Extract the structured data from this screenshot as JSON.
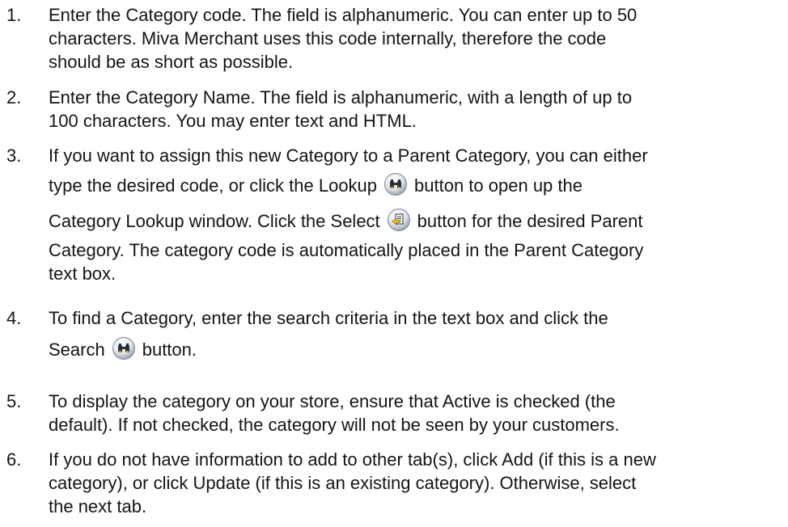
{
  "steps": [
    {
      "number": "1.",
      "lines": [
        "Enter the Category code. The field is alphanumeric. You can enter up to 50",
        "characters. Miva Merchant uses this code internally, therefore the code",
        "should be as short as possible."
      ]
    },
    {
      "number": "2.",
      "lines": [
        "Enter the Category Name. The field is alphanumeric, with a length of up to",
        "100 characters. You may enter text and HTML."
      ]
    },
    {
      "number": "3.",
      "line1": "If you want to assign this new Category to a Parent Category, you can either",
      "line2_before": "type the desired code, or click the Lookup",
      "line2_after": "button to open up the",
      "line3_before": "Category Lookup window. Click the Select",
      "line3_after": "button for the desired Parent",
      "line4": "Category. The category code is automatically placed in the Parent Category",
      "line5": "text box."
    },
    {
      "number": "4.",
      "line1": "To find a Category, enter the search criteria in the text box and click the",
      "line2_before": "Search",
      "line2_after": "button."
    },
    {
      "number": "5.",
      "lines": [
        "To display the category on your store, ensure that Active is checked (the",
        "default). If not checked, the category will not be seen by your customers."
      ]
    },
    {
      "number": "6.",
      "lines": [
        "If you do not have information to add to other tab(s), click Add (if this is a new",
        "category), or click Update (if this is an existing category). Otherwise, select",
        "the next tab."
      ]
    }
  ],
  "icons": {
    "lookup": "binoculars-icon",
    "select": "select-document-icon",
    "search": "binoculars-icon"
  }
}
